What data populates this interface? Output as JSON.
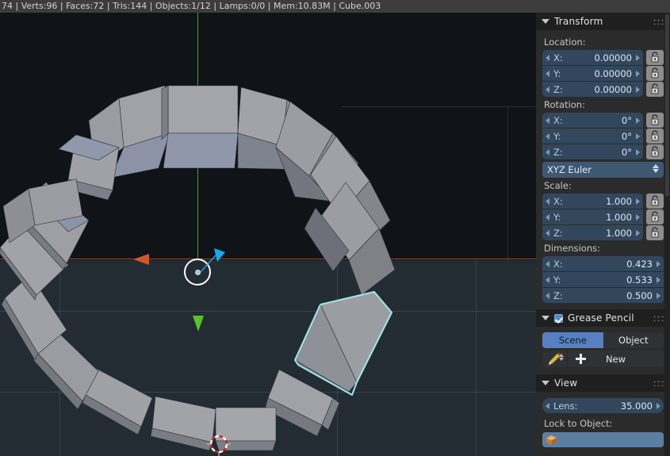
{
  "statusbar": {
    "text": "74 | Verts:96 | Faces:72 | Tris:144 | Objects:1/12 | Lamps:0/0 | Mem:10.83M | Cube.003",
    "stats": [
      {
        "label": "74"
      },
      {
        "label": "Verts:96"
      },
      {
        "label": "Faces:72"
      },
      {
        "label": "Tris:144"
      },
      {
        "label": "Objects:1/12"
      },
      {
        "label": "Lamps:0/0"
      },
      {
        "label": "Mem:10.83M"
      },
      {
        "label": "Cube.003"
      }
    ]
  },
  "viewport": {
    "background_color": "#101418",
    "ground_color": "#232c33",
    "grid_color": "#35444c",
    "axis_x_color": "#9c4a28",
    "axis_z_color": "#4a9c28",
    "selected_outline_color": "#9fe8e8",
    "cursor_name": "3d-cursor",
    "origin_name": "object-origin"
  },
  "transform": {
    "title": "Transform",
    "location": {
      "label": "Location:",
      "fields": [
        {
          "axis": "X:",
          "value": "0.00000"
        },
        {
          "axis": "Y:",
          "value": "0.00000"
        },
        {
          "axis": "Z:",
          "value": "0.00000"
        }
      ]
    },
    "rotation": {
      "label": "Rotation:",
      "fields": [
        {
          "axis": "X:",
          "value": "0°"
        },
        {
          "axis": "Y:",
          "value": "0°"
        },
        {
          "axis": "Z:",
          "value": "0°"
        }
      ],
      "mode": "XYZ Euler"
    },
    "scale": {
      "label": "Scale:",
      "fields": [
        {
          "axis": "X:",
          "value": "1.000"
        },
        {
          "axis": "Y:",
          "value": "1.000"
        },
        {
          "axis": "Z:",
          "value": "1.000"
        }
      ]
    },
    "dimensions": {
      "label": "Dimensions:",
      "fields": [
        {
          "axis": "X:",
          "value": "0.423"
        },
        {
          "axis": "Y:",
          "value": "0.533"
        },
        {
          "axis": "Z:",
          "value": "0.500"
        }
      ]
    }
  },
  "grease_pencil": {
    "title": "Grease Pencil",
    "checked": true,
    "source_toggle": {
      "options": [
        "Scene",
        "Object"
      ],
      "selected": "Scene"
    },
    "new_button": "New"
  },
  "view": {
    "title": "View",
    "lens": {
      "label": "Lens:",
      "value": "35.000"
    },
    "lock_to_object": {
      "label": "Lock to Object:",
      "value": ""
    }
  },
  "colors": {
    "panel_bg": "#2b2b2b",
    "header_bg": "#1f1f1f",
    "field_blue": "#33475c",
    "accent_blue": "#5680c2"
  }
}
